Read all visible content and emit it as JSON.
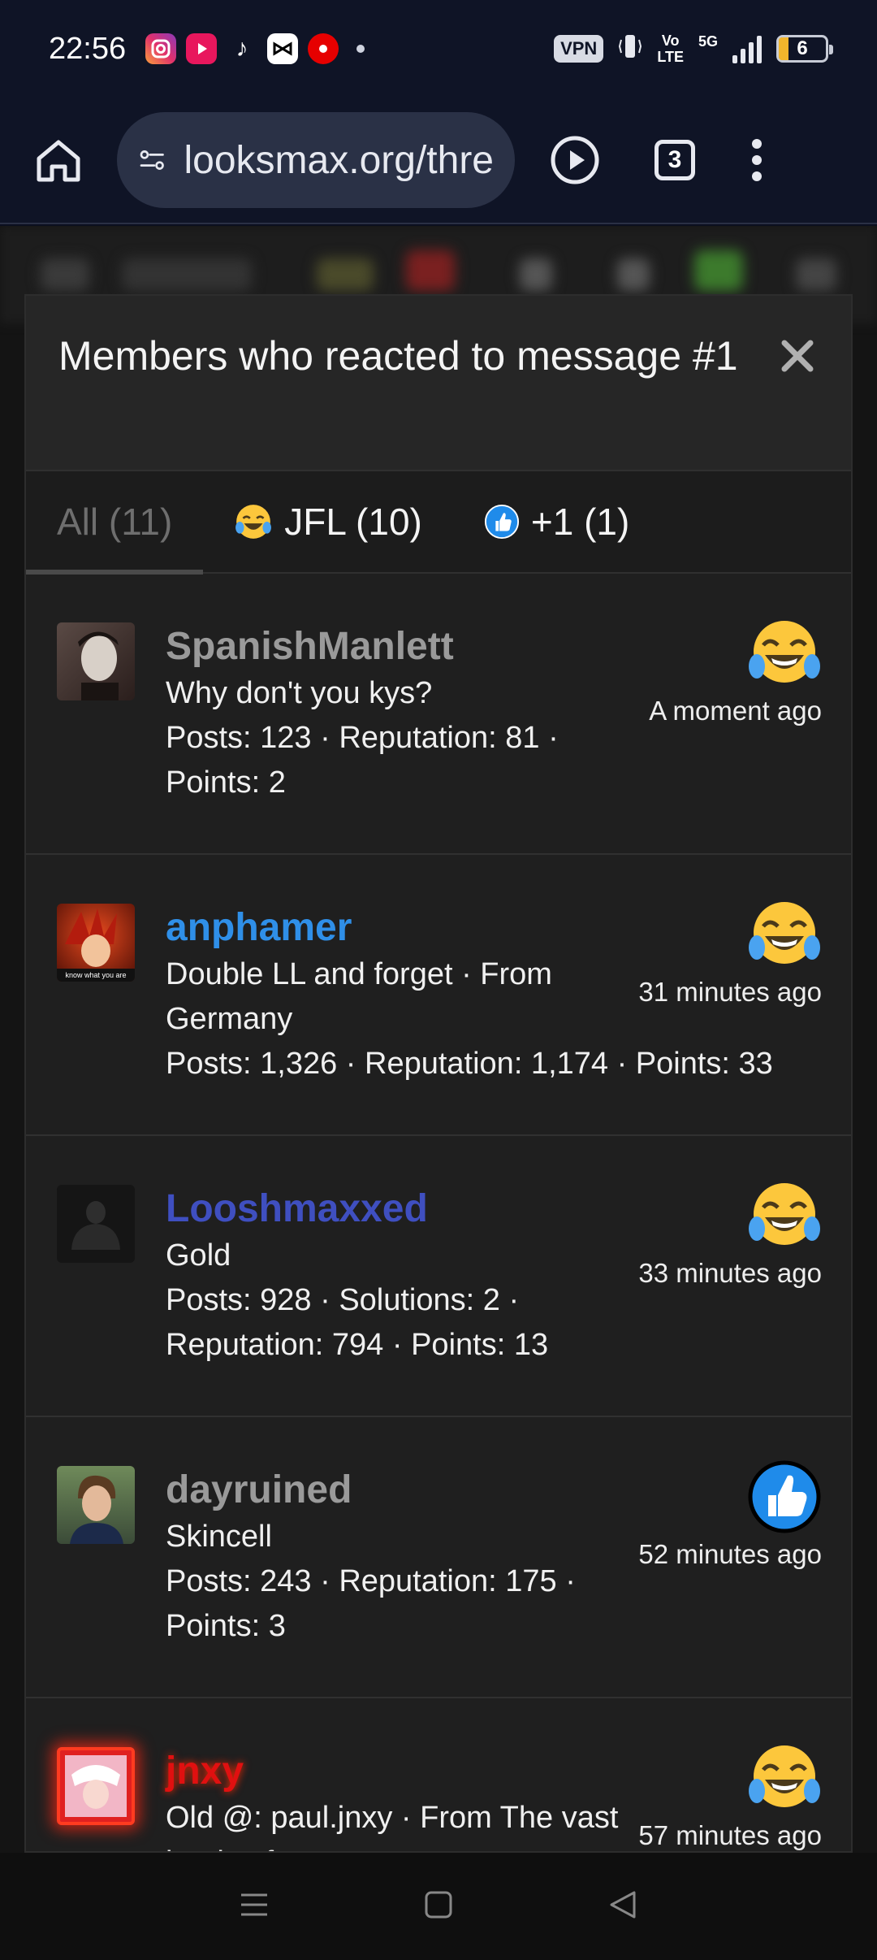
{
  "status_bar": {
    "time": "22:56",
    "vpn": "VPN",
    "volte_top": "Vo",
    "volte_bottom": "LTE",
    "network": "5G",
    "battery": "6"
  },
  "browser": {
    "url": "looksmax.org/thre",
    "tab_count": "3"
  },
  "modal": {
    "title": "Members who reacted to message #1",
    "tabs": [
      {
        "label": "All (11)",
        "active": true
      },
      {
        "label": "JFL (10)",
        "emoji": "crying-laughing"
      },
      {
        "label": "+1 (1)",
        "emoji": "thumbs-up"
      }
    ]
  },
  "members": [
    {
      "name": "SpanishManlett",
      "name_color": "#9a9a9a",
      "lines": [
        "Why don't you kys?",
        "Posts: 123 · Reputation: 81 ·",
        "Points: 2"
      ],
      "reaction": "crying-laughing",
      "time": "A moment ago"
    },
    {
      "name": "anphamer",
      "name_color": "#2f8fe8",
      "lines": [
        "Double LL and forget · From",
        "Germany",
        "Posts: 1,326 · Reputation: 1,174 · Points: 33"
      ],
      "reaction": "crying-laughing",
      "time": "31 minutes ago",
      "avatar_text": "know what you are"
    },
    {
      "name": "Looshmaxxed",
      "name_color": "#3f4fc0",
      "lines": [
        "Gold",
        "Posts: 928 · Solutions: 2 ·",
        "Reputation: 794 · Points: 13"
      ],
      "reaction": "crying-laughing",
      "time": "33 minutes ago"
    },
    {
      "name": "dayruined",
      "name_color": "#9a9a9a",
      "lines": [
        "Skincell",
        "Posts: 243 · Reputation: 175 ·",
        "Points: 3"
      ],
      "reaction": "thumbs-up",
      "time": "52 minutes ago"
    },
    {
      "name": "jnxy",
      "name_color": "#e01010",
      "lines": [
        "Old @: paul.jnxy · From The vast",
        "lands of"
      ],
      "reaction": "crying-laughing",
      "time": "57 minutes ago"
    }
  ]
}
